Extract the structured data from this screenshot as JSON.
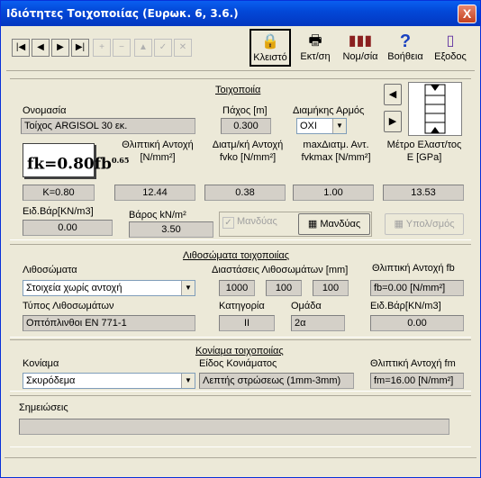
{
  "window": {
    "title": "Ιδιότητες Τοιχοποιίας (Ευρωκ. 6, 3.6.)",
    "close_label": "X"
  },
  "toolbar": {
    "nav_first": "|◀",
    "nav_prev": "◀",
    "nav_next": "▶",
    "nav_last": "▶|",
    "nav_add": "+",
    "nav_remove": "−",
    "nav_edit": "▲",
    "nav_post": "✓",
    "nav_cancel": "✕",
    "lock_label": "Κλειστό",
    "print_label": "Εκτ/ση",
    "units_label": "Νομ/σία",
    "help_label": "Βοήθεια",
    "exit_label": "Εξοδος"
  },
  "masonry": {
    "section_title": "Τοιχοποιία",
    "name_label": "Ονομασία",
    "name_value": "Τοίχος ARGISOL 30 εκ.",
    "thickness_label": "Πάχος [m]",
    "thickness_value": "0.300",
    "joint_label": "Διαμήκης Αρμός",
    "joint_value": "ΟΧΙ",
    "formula_text": "fk=0.80fb",
    "formula_sup": "0.65",
    "compressive_label_1": "Θλιπτική Αντοχή",
    "compressive_label_2": "[N/mm²]",
    "shear_label_1": "Διατμ/κή Αντοχή",
    "shear_label_2": "fvko [N/mm²]",
    "maxshear_label_1": "maxΔιατμ. Αντ.",
    "maxshear_label_2": "fvkmax [N/mm²]",
    "modulus_label_1": "Μέτρο Ελαστ/τος",
    "modulus_label_2": "Ε [GPa]",
    "k_value": "K=0.80",
    "compressive_value": "12.44",
    "shear_value": "0.38",
    "maxshear_value": "1.00",
    "modulus_value": "13.53",
    "unit_weight_label": "Ειδ.Βάρ[KN/m3]",
    "unit_weight_value": "0.00",
    "weight_label": "Βάρος kN/m²",
    "weight_value": "3.50",
    "mandyas_checkbox_label": "Μανδύας",
    "mandyas_button_label": "Μανδύας",
    "calc_button_label": "Υπολ/σμός"
  },
  "units": {
    "section_title": "Λιθοσώματα τοιχοποιίας",
    "units_label": "Λιθοσώματα",
    "units_value": "Στοιχεία χωρίς αντοχή",
    "dims_label": "Διαστάσεις Λιθοσωμάτων [mm]",
    "dim_1": "1000",
    "dim_2": "100",
    "dim_3": "100",
    "fb_label": "Θλιπτική Αντοχή fb",
    "fb_value": "fb=0.00 [N/mm²]",
    "type_label": "Τύπος Λιθοσωμάτων",
    "type_value": "Οπτόπλινθοι EN 771-1",
    "category_label": "Κατηγορία",
    "category_value": "II",
    "group_label": "Ομάδα",
    "group_value": "2α",
    "unit_weight_label": "Ειδ.Βάρ[KN/m3]",
    "unit_weight_value": "0.00"
  },
  "mortar": {
    "section_title": "Κονίαμα τοιχοποιίας",
    "mortar_label": "Κονίαμα",
    "mortar_value": "Σκυρόδεμα",
    "type_label": "Είδος Κονιάματος",
    "type_value": "Λεπτής στρώσεως (1mm-3mm)",
    "fm_label": "Θλιπτική Αντοχή fm",
    "fm_value": "fm=16.00 [N/mm²]"
  },
  "notes": {
    "label": "Σημειώσεις",
    "value": ""
  },
  "colors": {
    "title_bar": "#0348d8",
    "window_bg": "#ece9d8",
    "field_bg": "#d4d0c8"
  }
}
